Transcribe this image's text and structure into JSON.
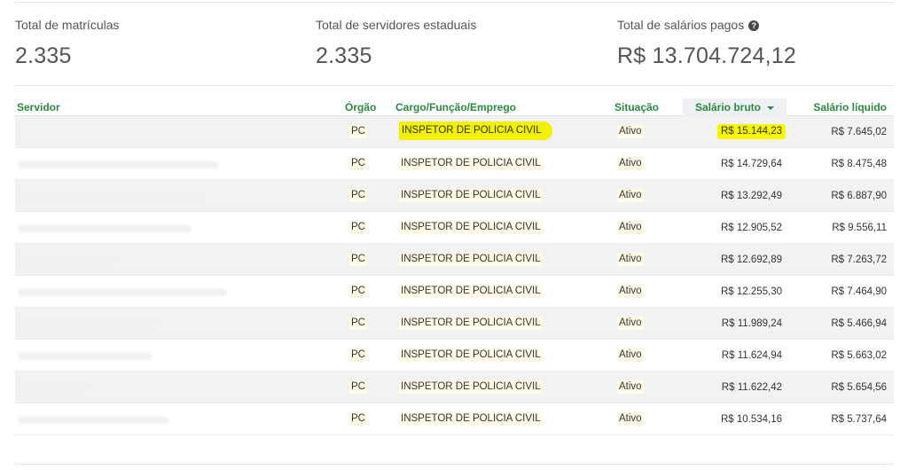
{
  "stats": [
    {
      "label": "Total de matrículas",
      "value": "2.335"
    },
    {
      "label": "Total de servidores estaduais",
      "value": "2.335"
    },
    {
      "label": "Total de salários pagos",
      "value": "R$ 13.704.724,12",
      "help_icon": "question-circle-icon"
    }
  ],
  "table": {
    "headers": {
      "servidor": "Servidor",
      "orgao": "Órgão",
      "cargo": "Cargo/Função/Emprego",
      "situacao": "Situação",
      "salario_bruto": "Salário bruto",
      "salario_liquido": "Salário líquido"
    },
    "sort_icon": "caret-down-icon",
    "rows": [
      {
        "orgao": "PC",
        "cargo": "INSPETOR DE POLICIA CIVIL",
        "situacao": "Ativo",
        "bruto": "R$ 15.144,23",
        "liquido": "R$ 7.645,02"
      },
      {
        "orgao": "PC",
        "cargo": "INSPETOR DE POLICIA CIVIL",
        "situacao": "Ativo",
        "bruto": "R$ 14.729,64",
        "liquido": "R$ 8.475,48"
      },
      {
        "orgao": "PC",
        "cargo": "INSPETOR DE POLICIA CIVIL",
        "situacao": "Ativo",
        "bruto": "R$ 13.292,49",
        "liquido": "R$ 6.887,90"
      },
      {
        "orgao": "PC",
        "cargo": "INSPETOR DE POLICIA CIVIL",
        "situacao": "Ativo",
        "bruto": "R$ 12.905,52",
        "liquido": "R$ 9.556,11"
      },
      {
        "orgao": "PC",
        "cargo": "INSPETOR DE POLICIA CIVIL",
        "situacao": "Ativo",
        "bruto": "R$ 12.692,89",
        "liquido": "R$ 7.263,72"
      },
      {
        "orgao": "PC",
        "cargo": "INSPETOR DE POLICIA CIVIL",
        "situacao": "Ativo",
        "bruto": "R$ 12.255,30",
        "liquido": "R$ 7.464,90"
      },
      {
        "orgao": "PC",
        "cargo": "INSPETOR DE POLICIA CIVIL",
        "situacao": "Ativo",
        "bruto": "R$ 11.989,24",
        "liquido": "R$ 5.466,94"
      },
      {
        "orgao": "PC",
        "cargo": "INSPETOR DE POLICIA CIVIL",
        "situacao": "Ativo",
        "bruto": "R$ 11.624,94",
        "liquido": "R$ 5.663,02"
      },
      {
        "orgao": "PC",
        "cargo": "INSPETOR DE POLICIA CIVIL",
        "situacao": "Ativo",
        "bruto": "R$ 11.622,42",
        "liquido": "R$ 5.654,56"
      },
      {
        "orgao": "PC",
        "cargo": "INSPETOR DE POLICIA CIVIL",
        "situacao": "Ativo",
        "bruto": "R$ 10.534,16",
        "liquido": "R$ 5.737,64"
      }
    ]
  },
  "colors": {
    "header_green": "#2b8a3e",
    "highlight_yellow": "#f7f700",
    "row_stripe": "#f2f2f2"
  }
}
